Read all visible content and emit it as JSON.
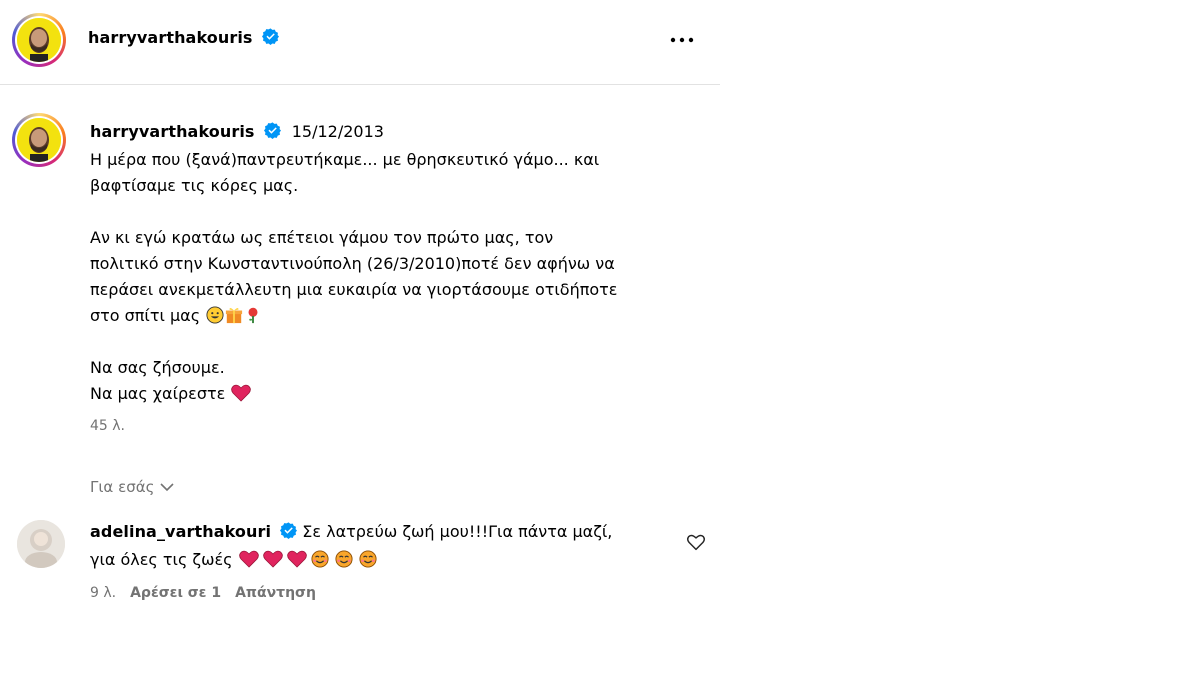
{
  "header": {
    "username": "harryvarthakouris",
    "verified": true,
    "more_icon": "more-horizontal-icon"
  },
  "post": {
    "username": "harryvarthakouris",
    "date": "15/12/2013",
    "caption_lines": [
      "Η μέρα που (ξανά)παντρευτήκαμε... με θρησκευτικό γάμο... και",
      "βαφτίσαμε τις κόρες μας.",
      "",
      "Αν κι εγώ κρατάω ως επέτειοι γάμου τον πρώτο μας, τον",
      "πολιτικό στην Κωνσταντινούπολη (26/3/2010)ποτέ δεν αφήνω να",
      "περάσει ανεκμετάλλευτη μια ευκαιρία να γιορτάσουμε οτιδήποτε",
      "στο σπίτι μας",
      "",
      "Να σας ζήσουμε.",
      "Να μας χαίρεστε"
    ],
    "time_ago": "45 λ."
  },
  "for_you": {
    "label": "Για εσάς",
    "icon": "chevron-down-icon"
  },
  "comment": {
    "username": "adelina_varthakouri",
    "verified": true,
    "text_line1": "Σε λατρεύω ζωή μου!!!Για πάντα μαζί,",
    "text_line2": "για όλες τις ζωές",
    "time_ago": "9 λ.",
    "likes_label": "Αρέσει σε 1",
    "reply_label": "Απάντηση",
    "like_icon": "heart-outline-icon"
  },
  "colors": {
    "verified_blue": "#0095f6",
    "meta_gray": "#737373",
    "heart_red": "#e0245e"
  }
}
